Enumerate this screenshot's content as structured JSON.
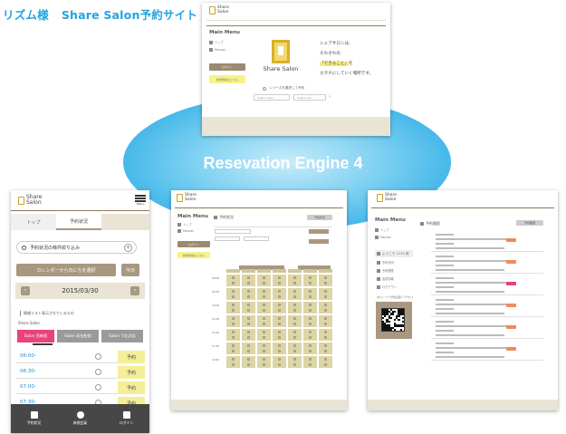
{
  "page": {
    "title_part1": "リズム様",
    "title_part2": "Share Salon予約サイト"
  },
  "hero": {
    "title": "Resevation Engine 4"
  },
  "brand": {
    "line1": "Share",
    "line2": "Salon"
  },
  "card_main": {
    "menu_title": "Main Menu",
    "menu_items": [
      {
        "label": "トップ",
        "icon": "home-icon"
      },
      {
        "label": "Manual",
        "icon": "book-icon"
      }
    ],
    "login_label": "ログイン",
    "register_label": "新規登録はこちら",
    "center_brand": "Share Salon",
    "tagline": {
      "line1": "シェアサロンは、",
      "line2": "それぞれの",
      "line3_highlight": "「できること」",
      "line3_rest": "を",
      "line4": "カタチにしていく場所です。"
    },
    "series_label": "シリーズを選択して予約",
    "select1": "Select salon",
    "select2": "Select use",
    "next_icon": "chevron-right-icon"
  },
  "card_phone": {
    "menu_label": "Menu",
    "tabs": [
      "トップ",
      "予約状況"
    ],
    "search_label": "予約状況の條件絞り込み",
    "calendar_button": "カレンダーから日にちを選択",
    "today_button": "今日",
    "date": "2015/03/30",
    "notice": "情報リスト表示されているもの",
    "salon_label": "Share Salon",
    "filters": [
      "Salon 西新宿",
      "Salon 初台駅前",
      "Salon 下北沢店"
    ],
    "rows": [
      {
        "time": "06:00-",
        "status": "○",
        "action": "予約"
      },
      {
        "time": "06:30-",
        "status": "○",
        "action": "予約"
      },
      {
        "time": "07:00-",
        "status": "○",
        "action": "予約"
      },
      {
        "time": "07:30-",
        "status": "○",
        "action": "予約"
      }
    ],
    "bottom_nav": [
      "予約状況",
      "新規会員",
      "ログイン"
    ],
    "colors": {
      "accent_blue": "#1a8dd6",
      "filter_pink": "#e8437e",
      "brown": "#a89880",
      "reserve_yellow": "#f3ee97"
    }
  },
  "card_grid": {
    "menu_title": "Main Menu",
    "section_title": "予約状況",
    "menu_items": [
      "トップ",
      "Manual"
    ],
    "login_label": "ログイン",
    "register_label": "新規登録はこちら",
    "tab_label": "予約状況",
    "times": [
      "09:00",
      "09:30",
      "10:00",
      "10:30",
      "11:00",
      "11:30",
      "12:00"
    ]
  },
  "card_list": {
    "menu_title": "Main Menu",
    "section_title": "予約履歴",
    "tab_label": "予約履歴",
    "menu_items": [
      "トップ",
      "Manual"
    ],
    "user_label": "ようこそ 1234 様",
    "side_items": [
      "予約状況",
      "予約履歴",
      "会員情報",
      "ログアウト"
    ],
    "qr_caption": "QRコードで予約画面へアクセス",
    "entries": [
      {
        "badge_color": "#f08a5d"
      },
      {
        "badge_color": "#f08a5d"
      },
      {
        "badge_color": "#e8437e"
      },
      {
        "badge_color": "#f08a5d"
      },
      {
        "badge_color": "#f08a5d"
      },
      {
        "badge_color": "#f08a5d"
      }
    ]
  }
}
